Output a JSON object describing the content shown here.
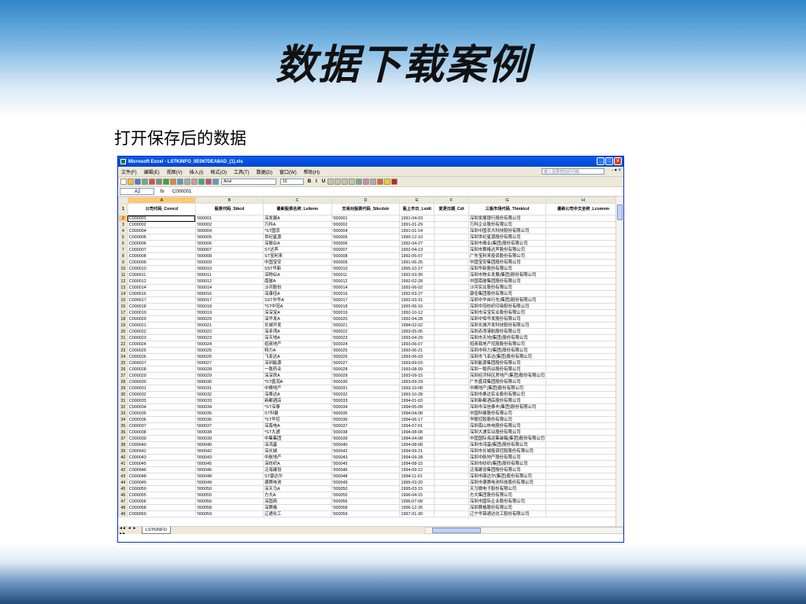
{
  "slide": {
    "title": "数据下载案例",
    "subtitle": "打开保存后的数据"
  },
  "window": {
    "title": "Microsoft Excel - LSTKINFO_0E067DEA8AD_(1).xls",
    "min": "_",
    "max": "□",
    "close": "×"
  },
  "menu": {
    "items": [
      "文件(F)",
      "编辑(E)",
      "视图(V)",
      "插入(I)",
      "格式(O)",
      "工具(T)",
      "数据(D)",
      "窗口(W)",
      "帮助(H)"
    ],
    "help_placeholder": "键入需要帮助的问题",
    "controls": "- ▾ ×"
  },
  "toolbar": {
    "font": "Arial",
    "size": "10",
    "bold": "B",
    "italic": "I",
    "underline": "U"
  },
  "formula": {
    "cell_ref": "A2",
    "fx": "fx",
    "value": "C000001"
  },
  "grid": {
    "columns": [
      "A",
      "B",
      "C",
      "D",
      "E",
      "F",
      "G",
      "H"
    ],
    "active_column": "A",
    "header_row_number": "1",
    "headers": [
      "公司代码_Comcd",
      "股票代码_Stkcd",
      "最新股票名称_Lstknm",
      "交易对股票代码_Stkcdstr",
      "股上市日_Lstdt",
      "变更日期_Cdt",
      "三板市场代码_Thinktcd",
      "最新公司中文全称_Lcomnm"
    ],
    "rows": [
      [
        "2",
        "C000001",
        "'000001",
        "深发展A",
        "'000001",
        "1991-04-03",
        "",
        "深圳发展银行股份有限公司"
      ],
      [
        "3",
        "C000002",
        "'000002",
        "万科A",
        "'000002",
        "1991-01-29",
        "",
        "万科企业股份有限公司"
      ],
      [
        "4",
        "C000004",
        "'000004",
        "*ST国农",
        "'000004",
        "1991-01-14",
        "",
        "深圳中国农大科技股份有限公司"
      ],
      [
        "5",
        "C000005",
        "'000005",
        "世纪星源",
        "'000005",
        "1990-12-10",
        "",
        "深圳世纪星源股份有限公司"
      ],
      [
        "6",
        "C000006",
        "'000006",
        "深振业A",
        "'000006",
        "1992-04-27",
        "",
        "深圳市振业(集团)股份有限公司"
      ],
      [
        "7",
        "C000007",
        "'000007",
        "ST达声",
        "'000007",
        "1992-04-13",
        "",
        "深圳市赛格达声股份有限公司"
      ],
      [
        "8",
        "C000008",
        "'000008",
        "ST宝利来",
        "'000008",
        "1992-05-07",
        "",
        "广东宝利来投资股份有限公司"
      ],
      [
        "9",
        "C000009",
        "'000009",
        "中国宝安",
        "'000009",
        "1991-06-25",
        "",
        "中国宝安集团股份有限公司"
      ],
      [
        "10",
        "C000010",
        "'000010",
        "SST华新",
        "'000010",
        "1995-10-27",
        "",
        "深圳华新股份有限公司"
      ],
      [
        "11",
        "C000011",
        "'000011",
        "深物业A",
        "'000011",
        "1992-03-30",
        "",
        "深圳市物业发展(集团)股份有限公司"
      ],
      [
        "12",
        "C000012",
        "'000012",
        "南玻A",
        "'000012",
        "1992-02-28",
        "",
        "中国南玻集团股份有限公司"
      ],
      [
        "13",
        "C000014",
        "'000014",
        "沙河股份",
        "'000014",
        "1992-06-02",
        "",
        "沙河实业股份有限公司"
      ],
      [
        "14",
        "C000016",
        "'000016",
        "深康佳A",
        "'000016",
        "1992-03-27",
        "",
        "康佳集团股份有限公司"
      ],
      [
        "15",
        "C000017",
        "'000017",
        "SST中华A",
        "'000017",
        "1992-03-31",
        "",
        "深圳中华自行车(集团)股份有限公司"
      ],
      [
        "16",
        "C000018",
        "'000018",
        "*ST中冠A",
        "'000018",
        "1992-06-16",
        "",
        "深圳中冠纺织印染股份有限公司"
      ],
      [
        "17",
        "C000019",
        "'000019",
        "深深宝A",
        "'000019",
        "1992-10-12",
        "",
        "深圳市深宝实业股份有限公司"
      ],
      [
        "18",
        "C000020",
        "'000020",
        "深华发A",
        "'000020",
        "1992-04-28",
        "",
        "深圳中恒华发股份有限公司"
      ],
      [
        "19",
        "C000021",
        "'000021",
        "长城开发",
        "'000021",
        "1994-02-02",
        "",
        "深圳长城开发科技股份有限公司"
      ],
      [
        "20",
        "C000022",
        "'000022",
        "深赤湾A",
        "'000022",
        "1993-05-05",
        "",
        "深圳赤湾港航股份有限公司"
      ],
      [
        "21",
        "C000023",
        "'000023",
        "深天地A",
        "'000023",
        "1993-04-29",
        "",
        "深圳市天地(集团)股份有限公司"
      ],
      [
        "22",
        "C000024",
        "'000024",
        "招商地产",
        "'000024",
        "1993-06-07",
        "",
        "招商局地产控股股份有限公司"
      ],
      [
        "23",
        "C000025",
        "'000025",
        "特力A",
        "'000025",
        "1993-06-21",
        "",
        "深圳市特力(集团)股份有限公司"
      ],
      [
        "24",
        "C000026",
        "'000026",
        "飞亚达A",
        "'000026",
        "1993-06-03",
        "",
        "深圳市飞亚达(集团)股份有限公司"
      ],
      [
        "25",
        "C000027",
        "'000027",
        "深圳能源",
        "'000027",
        "1993-09-03",
        "",
        "深圳能源集团股份有限公司"
      ],
      [
        "26",
        "C000028",
        "'000028",
        "一致药业",
        "'000028",
        "1993-08-09",
        "",
        "深圳一致药业股份有限公司"
      ],
      [
        "27",
        "C000029",
        "'000029",
        "深深房A",
        "'000029",
        "1993-09-15",
        "",
        "深圳经济特区房地产(集团)股份有限公司"
      ],
      [
        "28",
        "C000030",
        "'000030",
        "*ST盛润A",
        "'000030",
        "1993-09-29",
        "",
        "广东盛润集团股份有限公司"
      ],
      [
        "29",
        "C000031",
        "'000031",
        "中粮地产",
        "'000031",
        "1993-10-08",
        "",
        "中粮地产(集团)股份有限公司"
      ],
      [
        "30",
        "C000032",
        "'000032",
        "深桑达A",
        "'000032",
        "1993-10-28",
        "",
        "深圳市桑达实业股份有限公司"
      ],
      [
        "31",
        "C000033",
        "'000033",
        "新都酒店",
        "'000033",
        "1994-01-03",
        "",
        "深圳新都酒店股份有限公司"
      ],
      [
        "32",
        "C000034",
        "'000034",
        "*ST深泰",
        "'000034",
        "1994-05-09",
        "",
        "深圳市深信泰丰(集团)股份有限公司"
      ],
      [
        "33",
        "C000035",
        "'000035",
        "ST科健",
        "'000035",
        "1994-04-08",
        "",
        "中国科健股份有限公司"
      ],
      [
        "34",
        "C000036",
        "'000036",
        "*ST华控",
        "'000036",
        "1994-06-17",
        "",
        "华联控股股份有限公司"
      ],
      [
        "35",
        "C000037",
        "'000037",
        "深南电A",
        "'000037",
        "1994-07-01",
        "",
        "深圳南山热电股份有限公司"
      ],
      [
        "36",
        "C000038",
        "'000038",
        "*ST大通",
        "'000038",
        "1994-08-08",
        "",
        "深圳大通实业股份有限公司"
      ],
      [
        "37",
        "C000039",
        "'000039",
        "中集集团",
        "'000039",
        "1994-04-08",
        "",
        "中国国际海运集装箱(集团)股份有限公司"
      ],
      [
        "38",
        "C000040",
        "'000040",
        "深鸿基",
        "'000040",
        "1994-08-08",
        "",
        "深圳市鸿基(集团)股份有限公司"
      ],
      [
        "39",
        "C000042",
        "'000042",
        "深长城",
        "'000042",
        "1994-09-21",
        "",
        "深圳市长城投资控股股份有限公司"
      ],
      [
        "40",
        "C000043",
        "'000043",
        "中航地产",
        "'000043",
        "1994-09-28",
        "",
        "深圳中航地产股份有限公司"
      ],
      [
        "41",
        "C000045",
        "'000045",
        "深纺织A",
        "'000045",
        "1994-08-15",
        "",
        "深圳市纺织(集团)股份有限公司"
      ],
      [
        "42",
        "C000046",
        "'000046",
        "泛海建设",
        "'000046",
        "1994-09-12",
        "",
        "泛海建设集团股份有限公司"
      ],
      [
        "43",
        "C000048",
        "'000048",
        "ST康达尔",
        "'000048",
        "1994-11-01",
        "",
        "深圳市康达尔(集团)股份有限公司"
      ],
      [
        "44",
        "C000049",
        "'000049",
        "德赛电池",
        "'000049",
        "1995-03-20",
        "",
        "深圳市德赛电池科技股份有限公司"
      ],
      [
        "45",
        "C000050",
        "'000050",
        "深天马A",
        "'000050",
        "1995-03-15",
        "",
        "天马微电子股份有限公司"
      ],
      [
        "46",
        "C000055",
        "'000055",
        "方大A",
        "'000055",
        "1996-04-15",
        "",
        "方大集团股份有限公司"
      ],
      [
        "47",
        "C000056",
        "'000056",
        "深国商",
        "'000056",
        "1996-07-08",
        "",
        "深圳市国际企业股份有限公司"
      ],
      [
        "48",
        "C000058",
        "'000058",
        "深赛格",
        "'000058",
        "1996-12-26",
        "",
        "深圳赛格股份有限公司"
      ],
      [
        "49",
        "C000059",
        "'000059",
        "辽通化工",
        "'000059",
        "1997-01-30",
        "",
        "辽宁华锦通达化工股份有限公司"
      ]
    ]
  },
  "sheet_tabs": {
    "nav": "◂◂ ◂ ▸ ▸▸",
    "active": "LSTKINFO"
  },
  "colors": {
    "xp_blue": "#0a5ce6",
    "excel_chrome": "#ece9d8",
    "active_header": "#ffc770"
  }
}
